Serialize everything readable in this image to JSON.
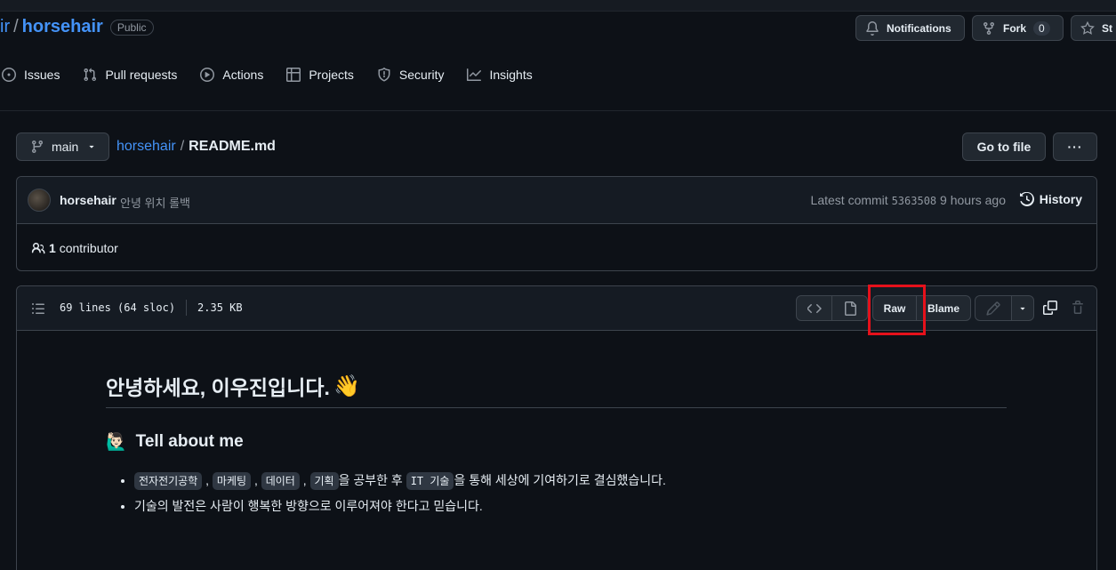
{
  "repo": {
    "owner": "ir",
    "sep": "/",
    "name": "horsehair",
    "visibility": "Public"
  },
  "header_buttons": {
    "notifications": "Notifications",
    "fork": "Fork",
    "fork_count": "0",
    "star": "St"
  },
  "tabs": [
    {
      "label": "Issues",
      "icon": "issue-icon"
    },
    {
      "label": "Pull requests",
      "icon": "pull-request-icon"
    },
    {
      "label": "Actions",
      "icon": "play-icon"
    },
    {
      "label": "Projects",
      "icon": "table-icon"
    },
    {
      "label": "Security",
      "icon": "shield-icon"
    },
    {
      "label": "Insights",
      "icon": "graph-icon"
    }
  ],
  "branch": "main",
  "breadcrumb": {
    "root": "horsehair",
    "sep": "/",
    "file": "README.md"
  },
  "go_to_file": "Go to file",
  "more_label": "···",
  "commit": {
    "author": "horsehair",
    "message": "안녕 위치 롤백",
    "latest_label": "Latest commit",
    "sha": "5363508",
    "time": "9 hours ago",
    "history": "History"
  },
  "contributors": {
    "count": "1",
    "label": "contributor"
  },
  "file": {
    "lines": "69 lines (64 sloc)",
    "size": "2.35 KB",
    "raw": "Raw",
    "blame": "Blame"
  },
  "readme": {
    "title": "안녕하세요, 이우진입니다.",
    "title_emoji": "👋",
    "section_emoji": "🙋🏻‍♂️",
    "section": "Tell about me",
    "item1_codes": [
      "전자전기공학",
      "마케팅",
      "데이터",
      "기획"
    ],
    "item1_mid": "을 공부한 후",
    "item1_code2": "IT 기술",
    "item1_end": "을 통해 세상에 기여하기로 결심했습니다.",
    "comma": ",",
    "item2": "기술의 발전은 사람이 행복한 방향으로 이루어져야 한다고 믿습니다."
  },
  "colors": {
    "accent": "#4493f8",
    "highlight": "#e5111b",
    "bg": "#0d1117"
  }
}
